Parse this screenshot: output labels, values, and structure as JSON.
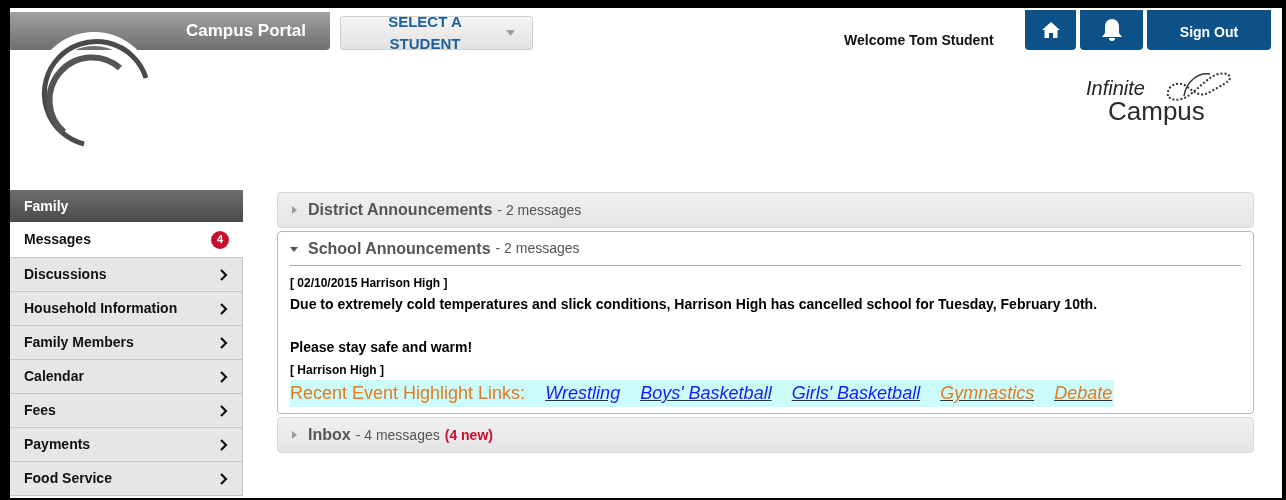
{
  "header": {
    "portal_title": "Campus Portal",
    "student_select": "SELECT A STUDENT",
    "welcome": "Welcome Tom Student",
    "sign_out": "Sign Out",
    "logo_top": "Infinite",
    "logo_bottom": "Campus"
  },
  "sidebar": {
    "heading": "Family",
    "items": [
      {
        "label": "Messages",
        "selected": true,
        "badge": "4"
      },
      {
        "label": "Discussions",
        "selected": false
      },
      {
        "label": "Household Information",
        "selected": false
      },
      {
        "label": "Family Members",
        "selected": false
      },
      {
        "label": "Calendar",
        "selected": false
      },
      {
        "label": "Fees",
        "selected": false
      },
      {
        "label": "Payments",
        "selected": false
      },
      {
        "label": "Food Service",
        "selected": false
      }
    ]
  },
  "sections": [
    {
      "title": "District Announcements",
      "count": "- 2 messages",
      "expanded": false
    },
    {
      "title": "School Announcements",
      "count": "- 2 messages",
      "expanded": true,
      "message": {
        "header": "[ 02/10/2015 Harrison High ]",
        "body": "Due to extremely cold temperatures and slick conditions, Harrison High has cancelled school for Tuesday, February 10th.",
        "closing": "Please stay safe and warm!",
        "signature": "[ Harrison High ]",
        "links_label": "Recent Event Highlight Links:",
        "links": [
          {
            "label": "Wrestling",
            "color": "#1a1aff"
          },
          {
            "label": "Boys' Basketball",
            "color": "#1a1aff"
          },
          {
            "label": "Girls' Basketball",
            "color": "#1a1aff"
          },
          {
            "label": "Gymnastics",
            "color": "#e07b1f"
          },
          {
            "label": "Debate",
            "color": "#e07b1f"
          }
        ]
      }
    },
    {
      "title": "Inbox",
      "count": "- 4 messages",
      "new": "(4 new)",
      "expanded": false
    }
  ]
}
